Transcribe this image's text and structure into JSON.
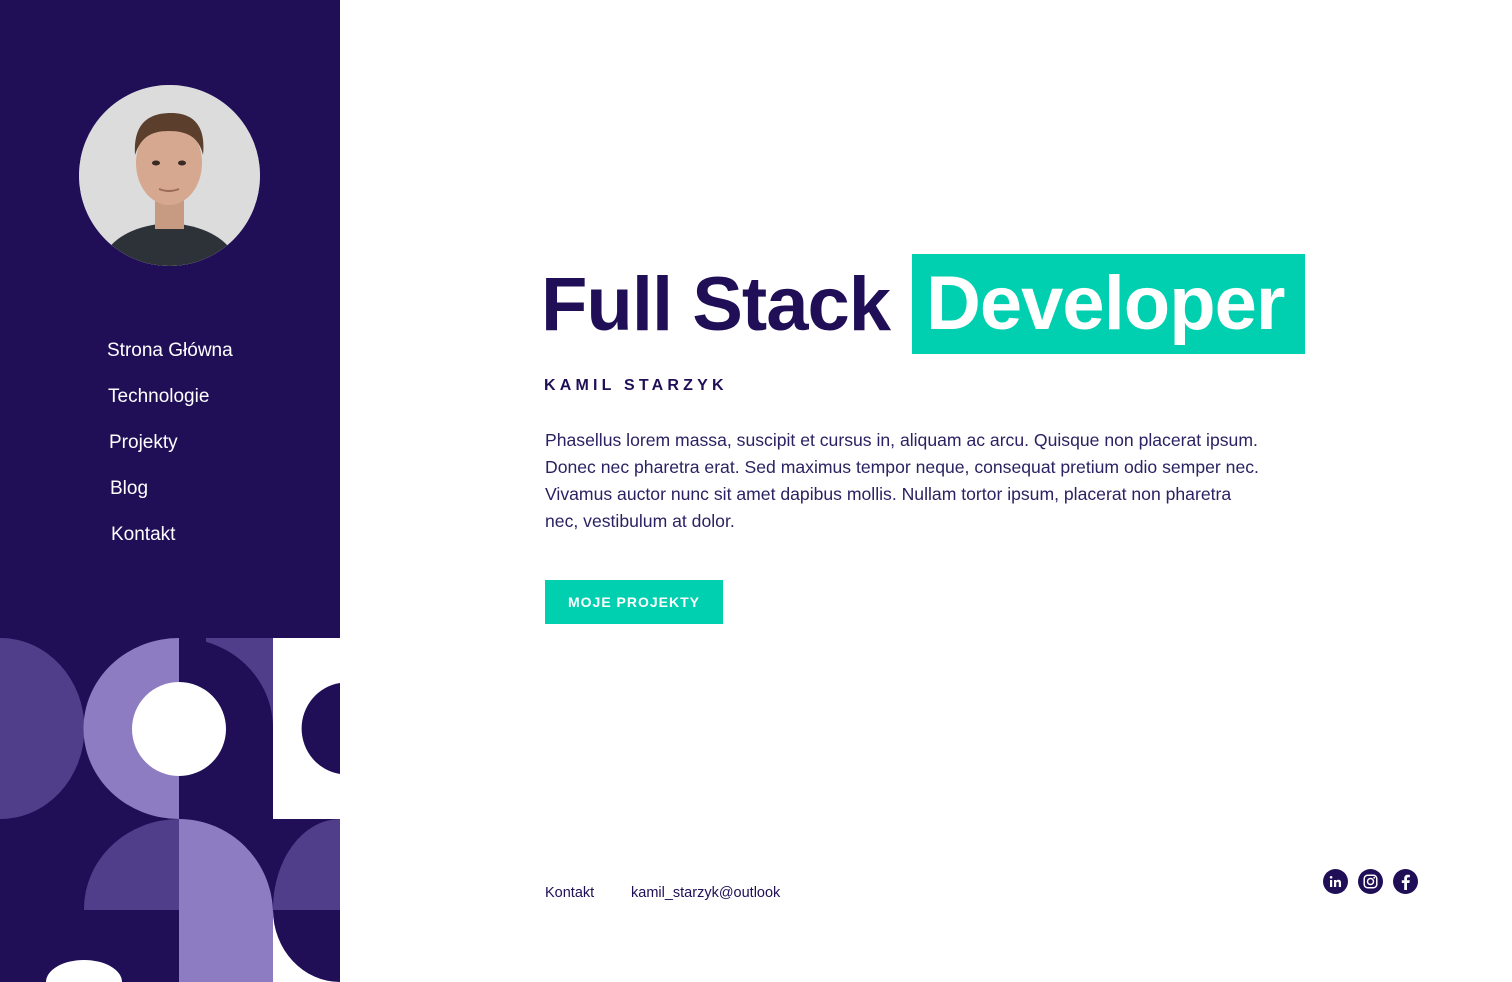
{
  "nav": {
    "items": [
      {
        "label": "Strona Główna"
      },
      {
        "label": "Technologie"
      },
      {
        "label": "Projekty"
      },
      {
        "label": "Blog"
      },
      {
        "label": "Kontakt"
      }
    ]
  },
  "hero": {
    "title_main": "Full Stack",
    "title_highlight": "Developer",
    "name": "KAMIL STARZYK",
    "description": "Phasellus lorem massa, suscipit et cursus in, aliquam ac arcu. Quisque non placerat ipsum. Donec nec pharetra erat. Sed maximus tempor neque, consequat pretium odio semper nec. Vivamus auctor nunc sit amet dapibus mollis. Nullam tortor ipsum, placerat non pharetra nec, vestibulum at dolor.",
    "cta_label": "MOJE PROJEKTY"
  },
  "footer": {
    "contact_label": "Kontakt",
    "email": "kamil_starzyk@outlook"
  },
  "social": [
    {
      "icon": "linkedin-icon"
    },
    {
      "icon": "instagram-icon"
    },
    {
      "icon": "facebook-icon"
    }
  ],
  "colors": {
    "sidebar_bg": "#200f57",
    "accent": "#00cfb0",
    "pattern_light": "#8e7cc3",
    "pattern_mid": "#513e8b",
    "text_dark": "#200f57"
  }
}
